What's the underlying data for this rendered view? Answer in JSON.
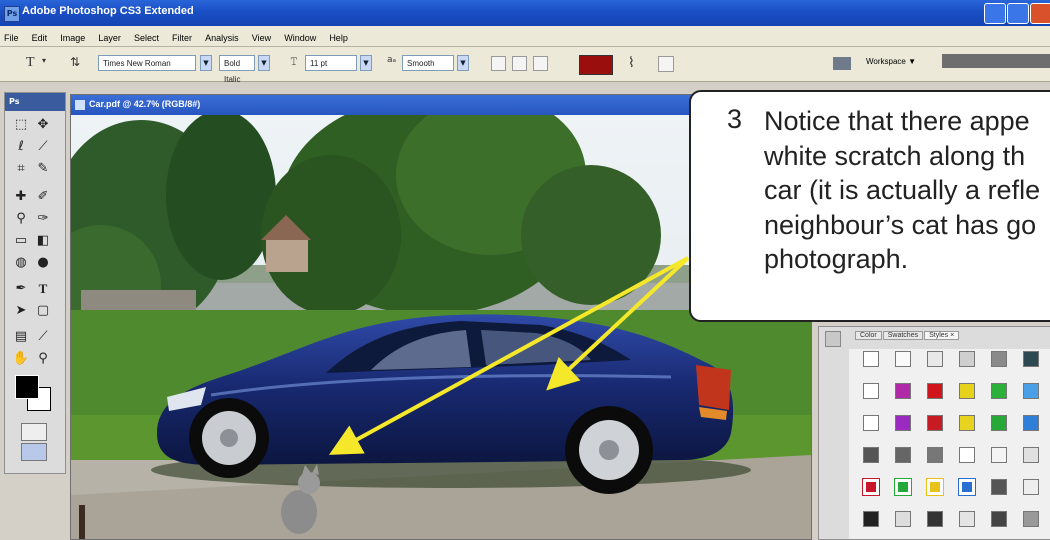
{
  "window": {
    "title": "Adobe Photoshop CS3 Extended",
    "icon": "photoshop-icon"
  },
  "menu": [
    "File",
    "Edit",
    "Image",
    "Layer",
    "Select",
    "Filter",
    "Analysis",
    "View",
    "Window",
    "Help"
  ],
  "options": {
    "tool_glyph": "T",
    "font_family": "Times New Roman",
    "font_style": "Bold Italic",
    "font_size": "11 pt",
    "antialias": "Smooth",
    "text_color": "#9a0e0e",
    "workspace": "Workspace ▼"
  },
  "tools_panel": {
    "title": "Ps"
  },
  "document": {
    "title": "Car.pdf @ 42.7% (RGB/8#)"
  },
  "palette": {
    "tabs": [
      "Color",
      "Swatches",
      "Styles ×"
    ]
  },
  "callout": {
    "number": "3",
    "lines": [
      "Notice that there appe",
      "white scratch along th",
      "car (it is actually a refle",
      "neighbour’s cat has go",
      "photograph."
    ]
  },
  "colors": {
    "arrow": "#f5e82a",
    "car": "#17286e",
    "title_blue": "#2a66d9"
  }
}
